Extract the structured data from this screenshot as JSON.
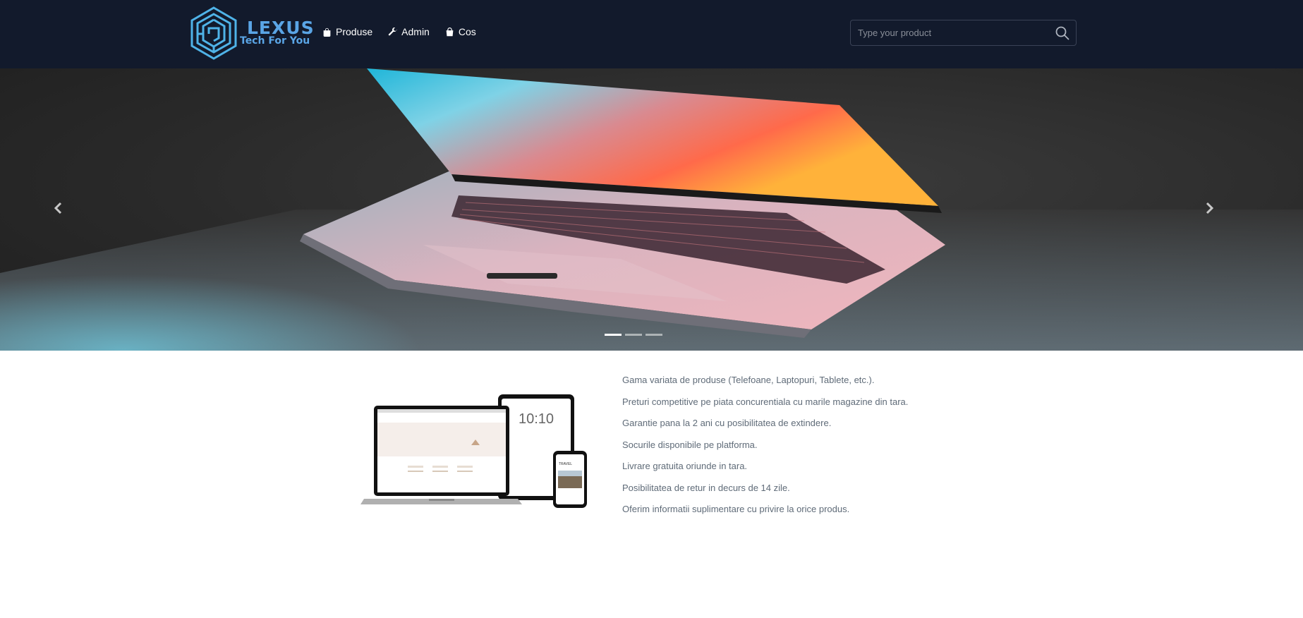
{
  "brand": {
    "name": "LEXUS",
    "tagline": "Tech For You",
    "logo_icon": "hexagon-maze-logo",
    "color": "#5aa5e6"
  },
  "nav": {
    "items": [
      {
        "label": "Produse",
        "icon": "shopping-bag-icon"
      },
      {
        "label": "Admin",
        "icon": "wrench-icon"
      },
      {
        "label": "Cos",
        "icon": "basket-icon"
      }
    ]
  },
  "search": {
    "placeholder": "Type your product",
    "value": "",
    "icon": "search-icon"
  },
  "carousel": {
    "slide_count": 3,
    "active_index": 0,
    "prev_icon": "chevron-left-icon",
    "next_icon": "chevron-right-icon"
  },
  "features": {
    "items": [
      "Gama variata de produse (Telefoane, Laptopuri, Tablete, etc.).",
      "Preturi competitive pe piata concurentiala cu marile magazine din tara.",
      "Garantie pana la 2 ani cu posibilitatea de extindere.",
      "Socurile disponibile pe platforma.",
      "Livrare gratuita oriunde in tara.",
      "Posibilitatea de retur in decurs de 14 zile.",
      "Oferim informatii suplimentare cu privire la orice produs."
    ],
    "devices_clock": "10:10"
  },
  "colors": {
    "navbar": "#121a2c",
    "text_muted": "#5f6b78",
    "accent": "#5aa5e6"
  }
}
